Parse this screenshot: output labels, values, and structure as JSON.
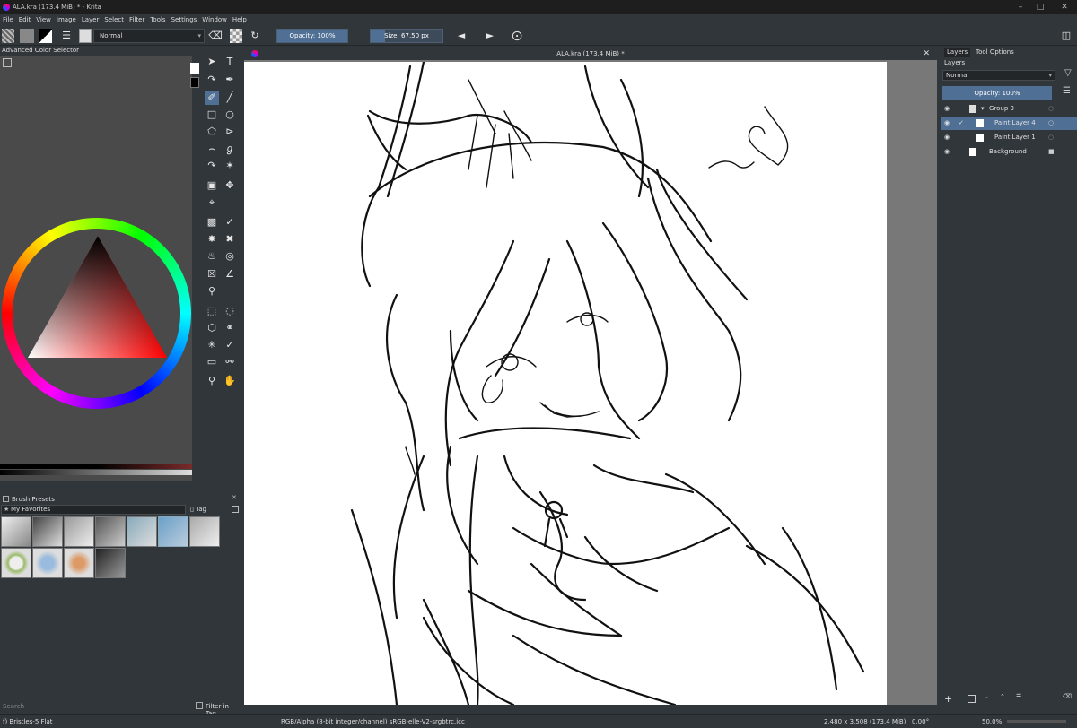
{
  "titlebar": {
    "title": "ALA.kra (173.4 MiB) * - Krita",
    "minimize_icon": "minimize-icon",
    "maximize_icon": "maximize-icon",
    "close_icon": "close-icon"
  },
  "menu": [
    "File",
    "Edit",
    "View",
    "Image",
    "Layer",
    "Select",
    "Filter",
    "Tools",
    "Settings",
    "Window",
    "Help"
  ],
  "toolbar": {
    "blend_mode": "Normal",
    "opacity": "Opacity: 100%",
    "opacity_value": 100,
    "size": "Size: 67.50 px",
    "size_fill_fraction": 0.2
  },
  "color_selector": {
    "title": "Advanced Color Selector"
  },
  "brush_presets": {
    "title": "Brush Presets",
    "filter": "My Favorites",
    "tag": "Tag",
    "search_placeholder": "Search",
    "filter_in_tag": "Filter in Tag"
  },
  "document": {
    "tab_title": "ALA.kra (173.4 MiB) *"
  },
  "layers_panel": {
    "tabs": [
      "Layers",
      "Tool Options"
    ],
    "title": "Layers",
    "blend_mode": "Normal",
    "opacity": "Opacity: 100%",
    "layers": [
      {
        "name": "Group 3",
        "selected": false
      },
      {
        "name": "Paint Layer 4",
        "selected": true
      },
      {
        "name": "Paint Layer 1",
        "selected": false
      },
      {
        "name": "Background",
        "selected": false
      }
    ]
  },
  "status": {
    "brush": "f) Bristles-5 Flat",
    "colorspace": "RGB/Alpha (8-bit integer/channel)  sRGB-elle-V2-srgbtrc.icc",
    "dimensions": "2,480 x 3,508 (173.4 MiB)",
    "rotation": "0.00°",
    "zoom": "50.0%"
  },
  "colors": {
    "accent": "#4f6f95",
    "panel": "#31363b",
    "dark": "#232629"
  }
}
